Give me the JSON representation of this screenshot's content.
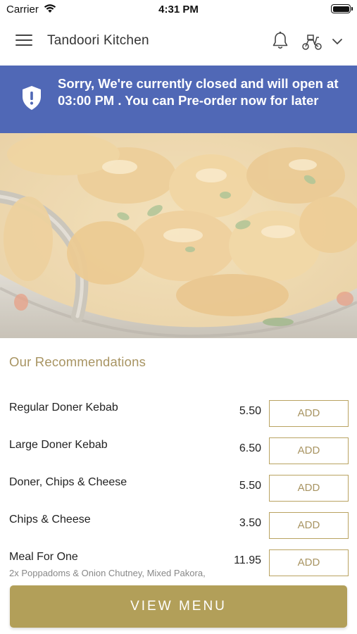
{
  "status_bar": {
    "carrier": "Carrier",
    "time": "4:31 PM"
  },
  "header": {
    "title": "Tandoori Kitchen",
    "icons": [
      "hamburger-menu-icon",
      "bell-icon",
      "delivery-scooter-icon",
      "chevron-down-icon"
    ]
  },
  "banner": {
    "message": "Sorry, We're currently closed and will open at 03:00 PM . You can Pre-order now for later",
    "icon": "shield-alert-icon",
    "color": "#5068b6"
  },
  "hero": {
    "subject": "curry dish photo"
  },
  "recommendations": {
    "title": "Our Recommendations",
    "add_label": "ADD",
    "items": [
      {
        "name": "Regular Doner Kebab",
        "price": "5.50",
        "description": ""
      },
      {
        "name": "Large Doner Kebab",
        "price": "6.50",
        "description": ""
      },
      {
        "name": "Doner, Chips & Cheese",
        "price": "5.50",
        "description": ""
      },
      {
        "name": "Chips & Cheese",
        "price": "3.50",
        "description": ""
      },
      {
        "name": "Meal For One",
        "price": "11.95",
        "description": "2x Poppadoms & Onion Chutney, Mixed Pakora,"
      }
    ]
  },
  "footer": {
    "view_menu_label": "VIEW MENU"
  },
  "colors": {
    "accent": "#b29f59",
    "banner": "#5068b6",
    "accent_text": "#a89462"
  }
}
